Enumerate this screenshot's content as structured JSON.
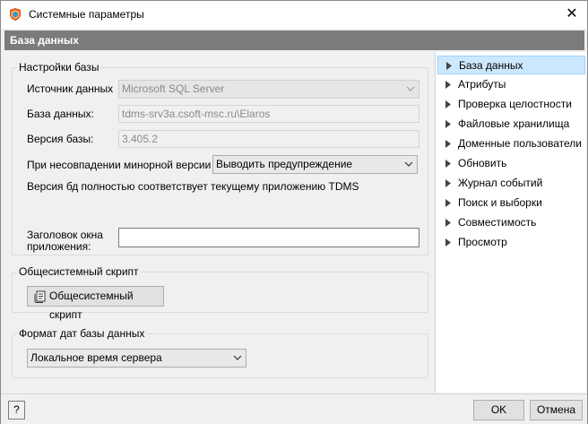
{
  "window": {
    "title": "Системные параметры",
    "close_glyph": "✕"
  },
  "header": {
    "title": "База данных"
  },
  "db_settings": {
    "legend": "Настройки базы",
    "source_label": "Источник данных",
    "source_value": "Microsoft SQL Server",
    "database_label": "База данных:",
    "database_value": "tdms-srv3a.csoft-msc.ru\\Elaros",
    "version_label": "Версия базы:",
    "version_value": "3.405.2",
    "mismatch_label": "При несовпадении минорной версии бд:",
    "mismatch_value": "Выводить предупреждение",
    "status_text": "Версия бд полностью соответствует текущему приложению TDMS",
    "app_title_label_line1": "Заголовок окна",
    "app_title_label_line2": "приложения:",
    "app_title_value": ""
  },
  "system_script": {
    "legend": "Общесистемный скрипт",
    "button_label": "Общесистемный скрипт"
  },
  "date_format": {
    "legend": "Формат дат базы данных",
    "value": "Локальное время сервера"
  },
  "nav": {
    "items": [
      {
        "label": "База данных",
        "selected": true
      },
      {
        "label": "Атрибуты"
      },
      {
        "label": "Проверка целостности"
      },
      {
        "label": "Файловые хранилища"
      },
      {
        "label": "Доменные пользователи"
      },
      {
        "label": "Обновить"
      },
      {
        "label": "Журнал событий"
      },
      {
        "label": "Поиск и выборки"
      },
      {
        "label": "Совместимость"
      },
      {
        "label": "Просмотр"
      }
    ]
  },
  "footer": {
    "help_glyph": "?",
    "ok_label": "OK",
    "cancel_label": "Отмена"
  },
  "icons": {
    "app": "app-shield-icon",
    "script": "script-icon",
    "help": "help-icon"
  },
  "colors": {
    "header_bg": "#7b7b7b",
    "selected_bg": "#cce8ff",
    "selected_border": "#99d1ff"
  }
}
